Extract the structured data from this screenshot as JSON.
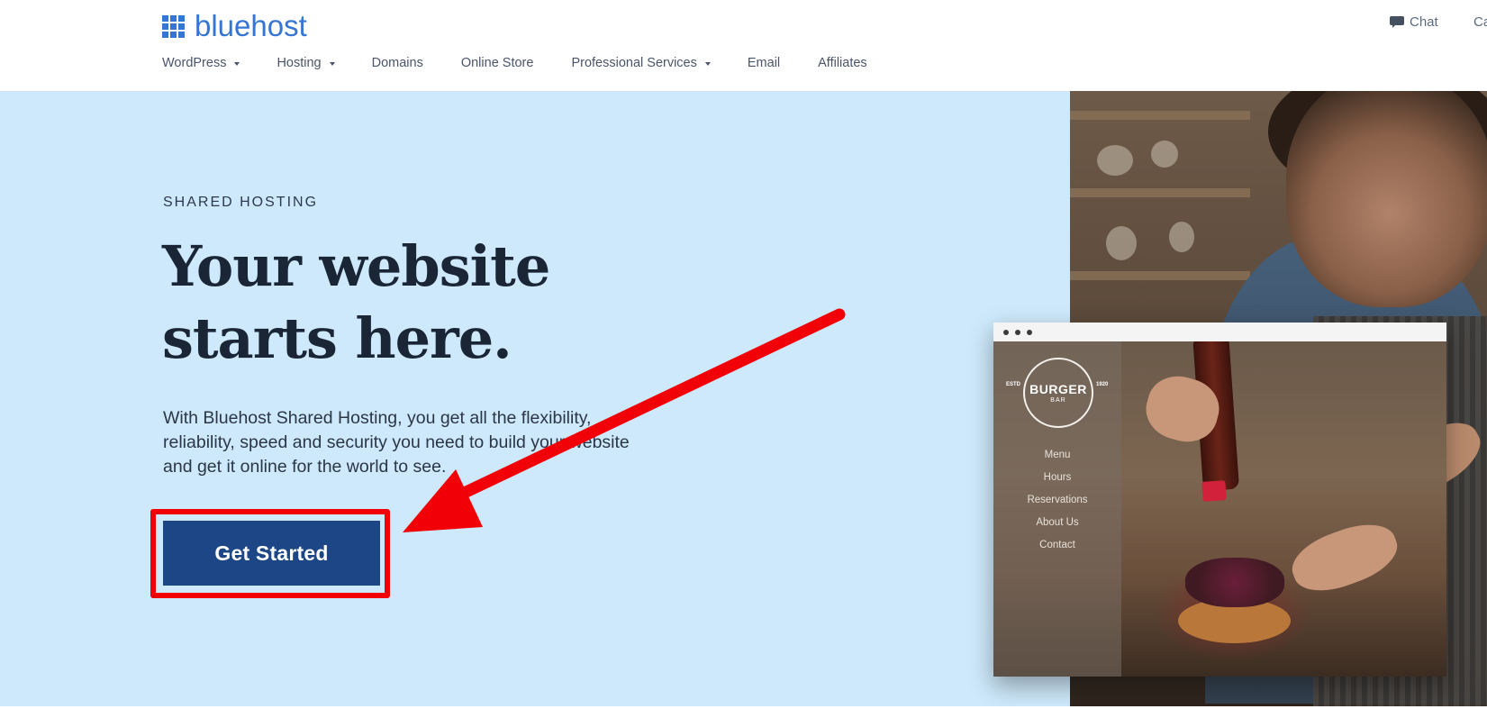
{
  "brand": {
    "name": "bluehost",
    "color": "#3575d3"
  },
  "topbar": {
    "chat_label": "Chat",
    "call_label": "Ca"
  },
  "nav": {
    "items": [
      {
        "label": "WordPress",
        "dropdown": true
      },
      {
        "label": "Hosting",
        "dropdown": true
      },
      {
        "label": "Domains",
        "dropdown": false
      },
      {
        "label": "Online Store",
        "dropdown": false
      },
      {
        "label": "Professional Services",
        "dropdown": true
      },
      {
        "label": "Email",
        "dropdown": false
      },
      {
        "label": "Affiliates",
        "dropdown": false
      }
    ]
  },
  "hero": {
    "eyebrow": "SHARED HOSTING",
    "headline": "Your website starts here.",
    "subtext": "With Bluehost Shared Hosting, you get all the flexibility, reliability, speed and security you need to build your website and get it online for the world to see.",
    "cta_label": "Get Started",
    "background": "#cde9fb",
    "cta_color": "#1d4687",
    "annotation_color": "#f20007"
  },
  "mockup": {
    "badge_main": "BURGER",
    "badge_sub": "BAR",
    "badge_left": "ESTD",
    "badge_right": "1920",
    "menu": [
      "Menu",
      "Hours",
      "Reservations",
      "About Us",
      "Contact"
    ]
  },
  "icons": [
    "logo-grid-icon",
    "chat-icon",
    "chevron-down-icon",
    "red-arrow-annotation"
  ]
}
